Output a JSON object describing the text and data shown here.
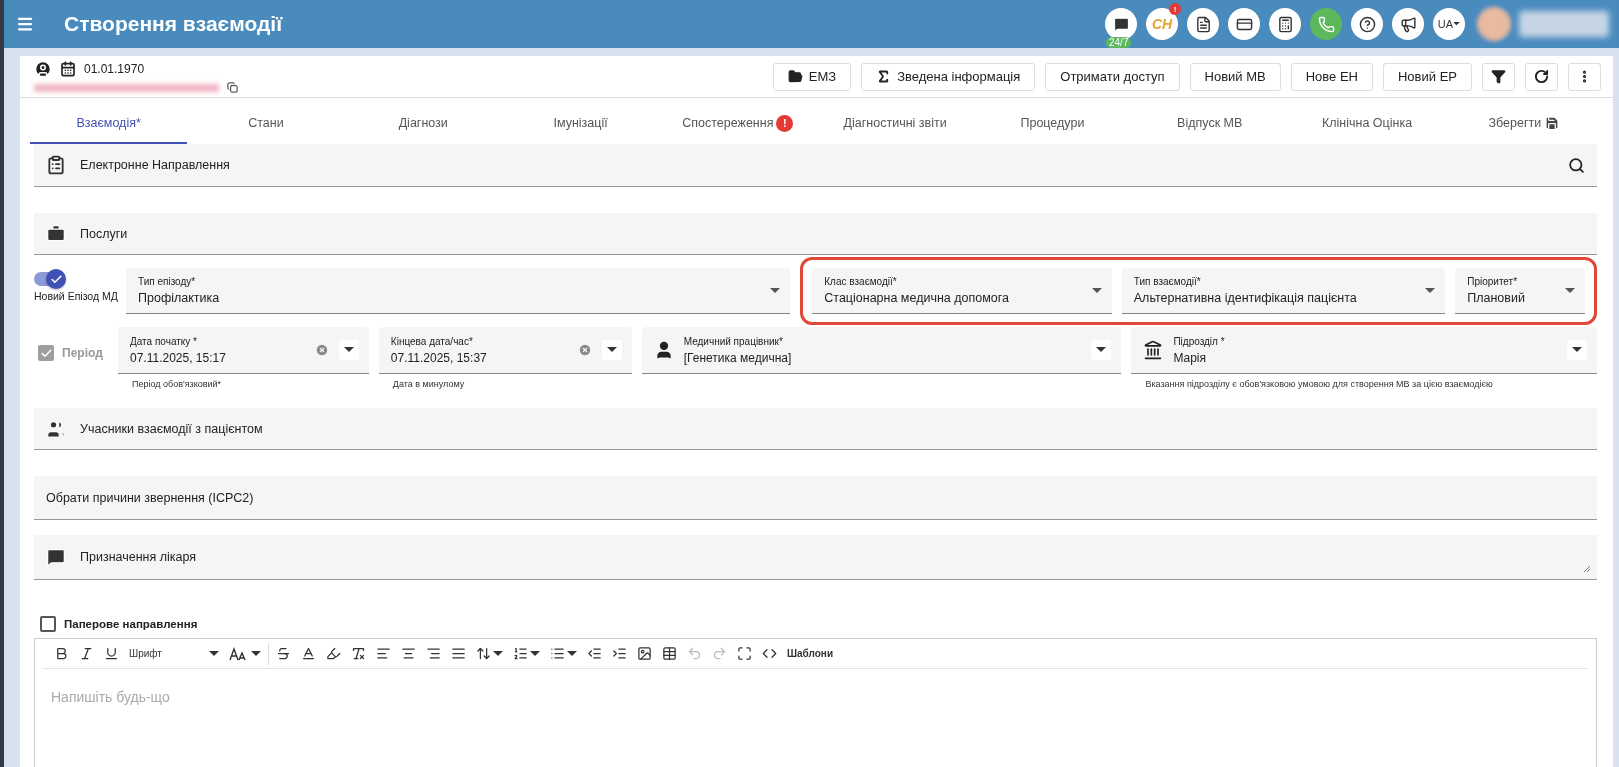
{
  "app_bar": {
    "title": "Створення взаємодії",
    "icons": [
      {
        "kind": "chat",
        "label": "24/7"
      },
      {
        "kind": "logo",
        "text": "CH",
        "badge": "!"
      },
      {
        "kind": "pdf"
      },
      {
        "kind": "card"
      },
      {
        "kind": "calculator"
      },
      {
        "kind": "phone"
      },
      {
        "kind": "help"
      },
      {
        "kind": "megaphone"
      },
      {
        "kind": "language",
        "text": "UA"
      }
    ]
  },
  "patient": {
    "birth_date": "01.01.1970"
  },
  "actions": [
    {
      "kind": "emz",
      "label": "ЕМЗ"
    },
    {
      "kind": "summary",
      "label": "Зведена інформація"
    },
    {
      "kind": "plain",
      "label": "Отримати доступ"
    },
    {
      "kind": "plain",
      "label": "Новий МВ"
    },
    {
      "kind": "plain",
      "label": "Нове ЕН"
    },
    {
      "kind": "plain",
      "label": "Новий ЕР"
    },
    {
      "kind": "filter"
    },
    {
      "kind": "refresh"
    },
    {
      "kind": "more"
    }
  ],
  "tabs": [
    {
      "label": "Взаємодія*",
      "selected": true
    },
    {
      "label": "Стани",
      "selected": false
    },
    {
      "label": "Діагнози",
      "selected": false
    },
    {
      "label": "Імунізації",
      "selected": false
    },
    {
      "label": "Спостереження",
      "selected": false,
      "badge": "!"
    },
    {
      "label": "Діагностичні звіти",
      "selected": false
    },
    {
      "label": "Процедури",
      "selected": false
    },
    {
      "label": "Відпуск МВ",
      "selected": false
    },
    {
      "label": "Клінічна Оцінка",
      "selected": false
    },
    {
      "label": "Зберегти",
      "selected": false,
      "kind": "save"
    }
  ],
  "sections_top": [
    {
      "kind": "clipboard",
      "label": "Електронне Направлення",
      "search": true
    },
    {
      "kind": "kit",
      "label": "Послуги",
      "search": false
    }
  ],
  "row1": {
    "toggle": {
      "label": "Новий Епізод МД",
      "on": true
    },
    "episode_type": {
      "label": "Тип епізоду*",
      "value": "Профілактика"
    },
    "highlight": {
      "on": true,
      "fields": [
        {
          "label": "Клас взаємодії*",
          "value": "Стаціонарна медична допомога"
        },
        {
          "label": "Тип взаємодії*",
          "value": "Альтернативна ідентифікація пацієнта"
        },
        {
          "label": "Пріоритет*",
          "value": "Плановий"
        }
      ]
    }
  },
  "row2": {
    "period": {
      "label": "Період",
      "checked": true,
      "disabled": true
    },
    "fields": [
      {
        "kind": "date",
        "label": "Дата початку *",
        "value": "07.11.2025, 15:17",
        "helper": "Період обов'язковий*"
      },
      {
        "kind": "date",
        "label": "Кінцева дата/час*",
        "value": "07.11.2025, 15:37",
        "helper": "Дата в минулому"
      },
      {
        "kind": "person",
        "label": "Медичний працівник*",
        "value": "[Генетика медична]"
      },
      {
        "kind": "department",
        "label": "Підрозділ *",
        "value": "Марія",
        "helper": "Вказання підрозділу є обов'язковою умовою для створення МВ за цією взаємодією"
      }
    ]
  },
  "sections_bottom": [
    {
      "kind": "users",
      "label": "Учасники взаємодії з пацієнтом"
    },
    {
      "kind": "plain",
      "label": "Обрати причини звернення (ICPC2)"
    },
    {
      "kind": "note",
      "label": "Призначення лікаря"
    }
  ],
  "paper_referral": {
    "label": "Паперове направлення",
    "checked": false
  },
  "editor": {
    "toolbar": [
      {
        "kind": "bold"
      },
      {
        "kind": "italic"
      },
      {
        "kind": "underline"
      },
      {
        "kind": "font",
        "label": "Шрифт"
      },
      {
        "kind": "size"
      },
      {
        "kind": "sep"
      },
      {
        "kind": "strike"
      },
      {
        "kind": "color"
      },
      {
        "kind": "highlight"
      },
      {
        "kind": "clear"
      },
      {
        "kind": "left"
      },
      {
        "kind": "center"
      },
      {
        "kind": "right"
      },
      {
        "kind": "justify"
      },
      {
        "kind": "lineheight"
      },
      {
        "kind": "ol"
      },
      {
        "kind": "ul"
      },
      {
        "kind": "outdent"
      },
      {
        "kind": "indent"
      },
      {
        "kind": "image"
      },
      {
        "kind": "table"
      },
      {
        "kind": "undo",
        "disabled": true
      },
      {
        "kind": "redo",
        "disabled": true
      },
      {
        "kind": "fullscreen"
      },
      {
        "kind": "code"
      },
      {
        "kind": "templates",
        "label": "Шаблони"
      }
    ],
    "placeholder": "Напишіть будь-що"
  }
}
